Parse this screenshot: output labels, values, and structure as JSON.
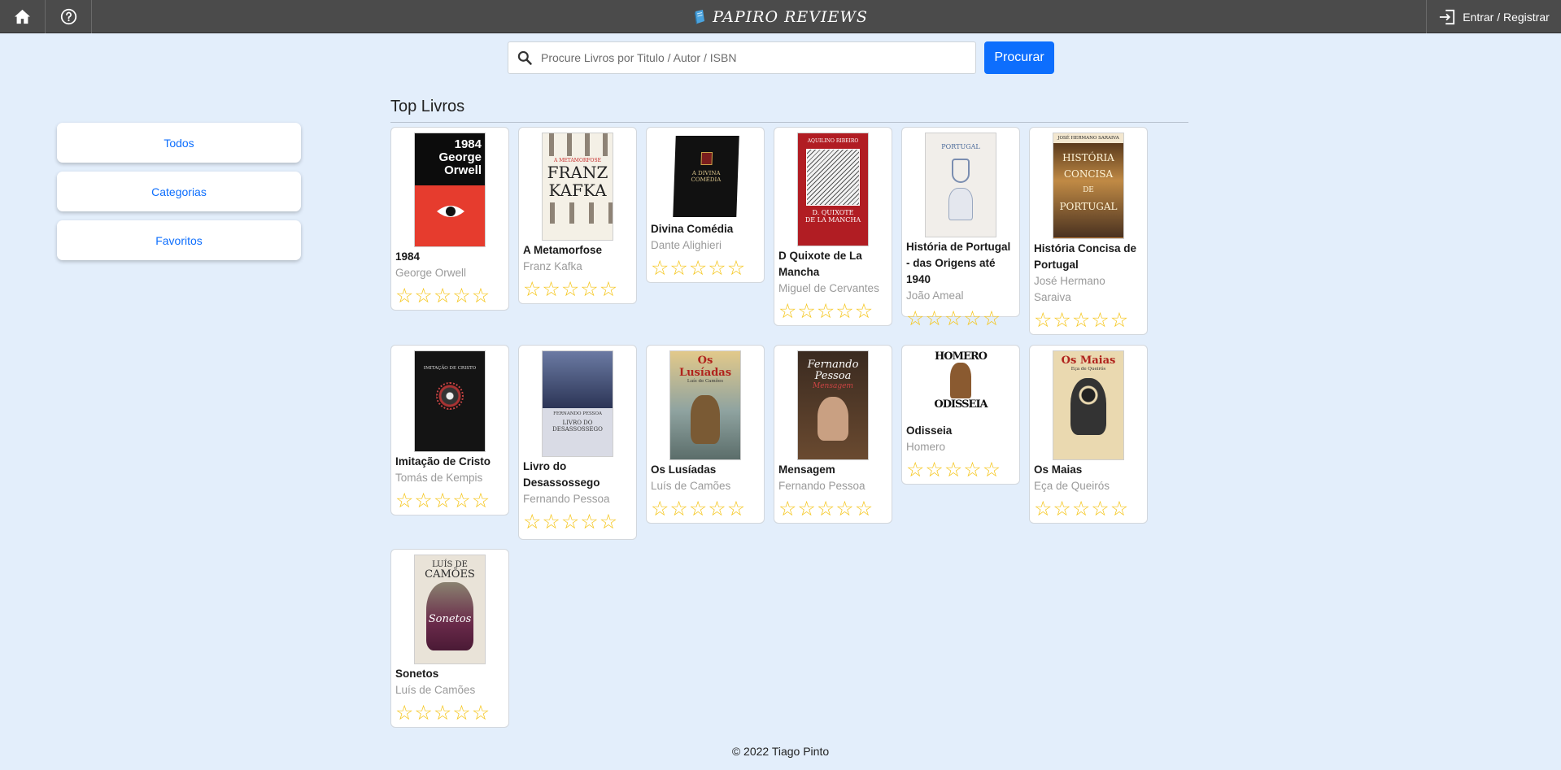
{
  "header": {
    "brand": "PAPIRO REVIEWS",
    "login_label": "Entrar / Registrar"
  },
  "search": {
    "placeholder": "Procure Livros por Titulo / Autor / ISBN",
    "button_label": "Procurar"
  },
  "sidebar": {
    "items": [
      {
        "label": "Todos"
      },
      {
        "label": "Categorias"
      },
      {
        "label": "Favoritos"
      }
    ]
  },
  "main": {
    "section_title": "Top Livros",
    "books": [
      {
        "title": "1984",
        "author": "George Orwell",
        "cover_lines": [
          "1984",
          "George",
          "Orwell"
        ],
        "rating": 0
      },
      {
        "title": "A Metamorfose",
        "author": "Franz Kafka",
        "cover_lines": [
          "A METAMORFOSE",
          "FRANZ",
          "KAFKA"
        ],
        "rating": 0
      },
      {
        "title": "Divina Comédia",
        "author": "Dante Alighieri",
        "cover_lines": [
          "A DIVINA",
          "COMÉDIA"
        ],
        "rating": 0
      },
      {
        "title": "D Quixote de La Mancha",
        "author": "Miguel de Cervantes",
        "cover_lines": [
          "AQUILINO RIBEIRO",
          "D. QUIXOTE",
          "DE LA MANCHA"
        ],
        "rating": 0
      },
      {
        "title": "História de Portugal - das Origens até 1940",
        "author": "João Ameal",
        "cover_lines": [
          "PORTUGAL"
        ],
        "rating": 0
      },
      {
        "title": "História Concisa de Portugal",
        "author": "José Hermano Saraiva",
        "cover_lines": [
          "JOSÉ HERMANO SARAIVA",
          "HISTÓRIA",
          "CONCISA",
          "DE",
          "PORTUGAL"
        ],
        "rating": 0
      },
      {
        "title": "Imitação de Cristo",
        "author": "Tomás de Kempis",
        "cover_lines": [
          "IMITAÇÃO DE CRISTO"
        ],
        "rating": 0
      },
      {
        "title": "Livro do Desassossego",
        "author": "Fernando Pessoa",
        "cover_lines": [
          "FERNANDO PESSOA",
          "LIVRO DO",
          "DESASSOSSEGO"
        ],
        "rating": 0
      },
      {
        "title": "Os Lusíadas",
        "author": "Luís de Camões",
        "cover_lines": [
          "Os Lusíadas",
          "Luís de Camões"
        ],
        "rating": 0
      },
      {
        "title": "Mensagem",
        "author": "Fernando Pessoa",
        "cover_lines": [
          "Fernando",
          "Pessoa",
          "Mensagem"
        ],
        "rating": 0
      },
      {
        "title": "Odisseia",
        "author": "Homero",
        "cover_lines": [
          "HOMERO",
          "ODISSEIA"
        ],
        "rating": 0
      },
      {
        "title": "Os Maias",
        "author": "Eça de Queirós",
        "cover_lines": [
          "Os Maias",
          "Eça de Queirós"
        ],
        "rating": 0
      },
      {
        "title": "Sonetos",
        "author": "Luís de Camões",
        "cover_lines": [
          "LUÍS DE",
          "CAMÕES",
          "Sonetos"
        ],
        "rating": 0
      }
    ]
  },
  "footer": {
    "text": "© 2022 Tiago Pinto"
  },
  "icons": {
    "home": "home-icon",
    "help": "help-circle-icon",
    "brand": "book-icon",
    "login": "login-icon",
    "search": "search-icon",
    "star": "star-outline-icon"
  },
  "colors": {
    "topbar": "#4b4b4b",
    "page_bg": "#e3eefb",
    "accent": "#0d6efd",
    "star": "#f5c518"
  }
}
